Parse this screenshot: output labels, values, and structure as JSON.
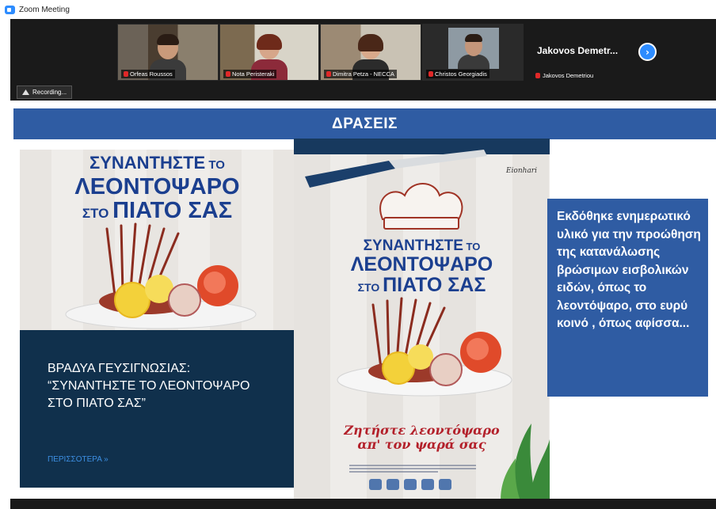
{
  "window": {
    "title": "Zoom Meeting",
    "accent": "#2d8cff"
  },
  "participants": [
    {
      "name": "Orfeas Roussos"
    },
    {
      "name": "Nota Peristeraki"
    },
    {
      "name": "Dimitra Petza - NECCA"
    },
    {
      "name": "Christos Georgiadis"
    }
  ],
  "active_speaker": {
    "big_name": "Jakovos Demetr...",
    "name": "Jakovos Demetriou"
  },
  "recording": {
    "label": "Recording..."
  },
  "slide": {
    "banner": "ΔΡΑΣΕΙΣ",
    "banner_color": "#2f5ca3",
    "card": {
      "poster_line1": "ΣΥΝΑΝΤΗΣΤΕ",
      "poster_line1_small": " ΤΟ",
      "poster_line2": "ΛΕΟΝΤΟΨΑΡΟ",
      "poster_line3_small": "ΣΤΟ ",
      "poster_line3": "ΠΙΑΤΟ ΣΑΣ",
      "event_title": "ΒΡΑΔΥΑ ΓΕΥΣΙΓΝΩΣΙΑΣ: “ΣΥΝΑΝΤΗΣΤΕ ΤΟ ΛΕΟΝΤΟΨΑΡΟ ΣΤΟ ΠΙΑΤΟ ΣΑΣ”",
      "more_link": "ΠΕΡΙΣΣΟΤΕΡΑ »"
    },
    "poster": {
      "brand": "Eionhari",
      "line1": "ΣΥΝΑΝΤΗΣΤΕ",
      "line1_small": " ΤΟ",
      "line2": "ΛΕΟΝΤΟΨΑΡΟ",
      "line3_small": "ΣΤΟ ",
      "line3": "ΠΙΑΤΟ ΣΑΣ",
      "slogan_line1": "Ζητήστε λεοντόψαρο",
      "slogan_line2": "απ' τον ψαρά σας"
    },
    "info_text": "Εκδόθηκε ενημερωτικό υλικό για την προώθηση της κατανάλωσης βρώσιμων εισβολικών ειδών, όπως το λεοντόψαρο, στο ευρύ κοινό , όπως αφίσσα..."
  }
}
